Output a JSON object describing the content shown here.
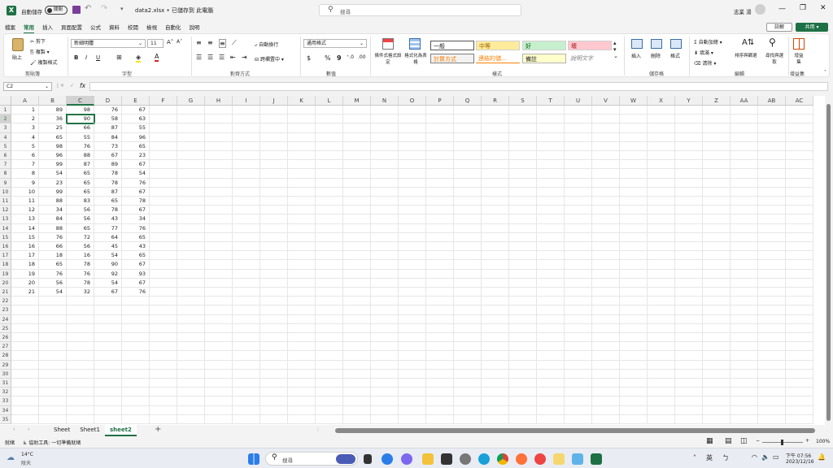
{
  "title_bar": {
    "autosave": "自動儲存",
    "toggle": "關閉",
    "filename": "data2.xlsx • 已儲存到 此電腦",
    "search_placeholder": "搜尋",
    "user": "志業 湯"
  },
  "menu_tabs": [
    "檔案",
    "常用",
    "插入",
    "頁面配置",
    "公式",
    "資料",
    "校閱",
    "檢視",
    "自動化",
    "說明"
  ],
  "ribbon_right": {
    "comment": "註解",
    "share": "共用"
  },
  "ribbon": {
    "clipboard": {
      "paste": "貼上",
      "cut": "剪下",
      "copy": "複製",
      "format_painter": "複製格式",
      "label": "剪貼簿"
    },
    "font": {
      "name": "新細明體",
      "size": "11",
      "label": "字型",
      "bold": "B",
      "italic": "I",
      "underline": "U"
    },
    "alignment": {
      "wrap": "自動換行",
      "merge": "跨欄置中",
      "label": "對齊方式"
    },
    "number": {
      "format": "通用格式",
      "label": "數值",
      "currency": "$",
      "percent": "%",
      "comma": "9"
    },
    "styles": {
      "conditional": "條件式格式設定",
      "table": "格式化為表格",
      "items": [
        "一般",
        "中等",
        "好",
        "壞",
        "計算方式",
        "連結的儲...",
        "備註",
        "說明文字"
      ],
      "label": "樣式"
    },
    "cells": {
      "insert": "插入",
      "delete": "刪除",
      "format": "格式",
      "label": "儲存格"
    },
    "editing": {
      "autosum": "自動加總",
      "fill": "填滿",
      "clear": "清除",
      "sort": "排序與篩選",
      "find": "尋找與選取",
      "label": "編輯"
    },
    "addins": {
      "btn": "增益集",
      "label": "增益集"
    }
  },
  "name_box": "C2",
  "fx": "fx",
  "columns": [
    "A",
    "B",
    "C",
    "D",
    "E",
    "F",
    "G",
    "H",
    "I",
    "J",
    "K",
    "L",
    "M",
    "N",
    "O",
    "P",
    "Q",
    "R",
    "S",
    "T",
    "U",
    "V",
    "W",
    "X",
    "Y",
    "Z",
    "AA",
    "AB",
    "AC"
  ],
  "rows": [
    [
      1,
      89,
      98,
      76,
      67
    ],
    [
      2,
      36,
      90,
      58,
      63
    ],
    [
      3,
      25,
      66,
      87,
      55
    ],
    [
      4,
      65,
      55,
      84,
      96
    ],
    [
      5,
      98,
      76,
      73,
      65
    ],
    [
      6,
      96,
      88,
      67,
      23
    ],
    [
      7,
      99,
      87,
      89,
      67
    ],
    [
      8,
      54,
      65,
      78,
      54
    ],
    [
      9,
      23,
      65,
      78,
      76
    ],
    [
      10,
      99,
      65,
      87,
      67
    ],
    [
      11,
      88,
      83,
      65,
      78
    ],
    [
      12,
      34,
      56,
      78,
      67
    ],
    [
      13,
      84,
      56,
      43,
      34
    ],
    [
      14,
      88,
      65,
      77,
      76
    ],
    [
      15,
      76,
      72,
      64,
      65
    ],
    [
      16,
      66,
      56,
      45,
      43
    ],
    [
      17,
      18,
      16,
      54,
      65
    ],
    [
      18,
      65,
      78,
      90,
      67
    ],
    [
      19,
      76,
      76,
      92,
      93
    ],
    [
      20,
      56,
      78,
      54,
      67
    ],
    [
      21,
      54,
      32,
      67,
      76
    ]
  ],
  "row_count": 35,
  "sheets": [
    "Sheet",
    "Sheet1",
    "sheet2"
  ],
  "active_sheet": "sheet2",
  "status": {
    "ready": "就緒",
    "accessibility": "協助工具: 一切準備就緒",
    "zoom": "100%"
  },
  "taskbar": {
    "weather_temp": "14°C",
    "weather_desc": "陰天",
    "search": "搜尋",
    "ime": "英",
    "time": "下午 07:56",
    "date": "2023/12/16"
  },
  "colors": {
    "accent": "#1e7145",
    "selected": "#217346"
  }
}
